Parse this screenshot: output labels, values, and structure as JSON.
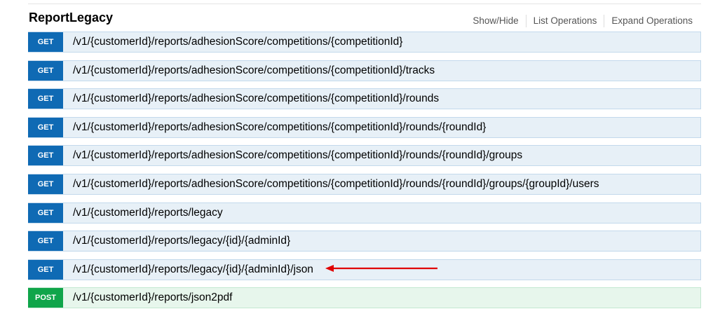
{
  "resource": {
    "title": "ReportLegacy",
    "actions": {
      "show_hide": "Show/Hide",
      "list_operations": "List Operations",
      "expand_operations": "Expand Operations"
    }
  },
  "endpoints": [
    {
      "method": "GET",
      "path": "/v1/{customerId}/reports/adhesionScore/competitions/{competitionId}"
    },
    {
      "method": "GET",
      "path": "/v1/{customerId}/reports/adhesionScore/competitions/{competitionId}/tracks"
    },
    {
      "method": "GET",
      "path": "/v1/{customerId}/reports/adhesionScore/competitions/{competitionId}/rounds"
    },
    {
      "method": "GET",
      "path": "/v1/{customerId}/reports/adhesionScore/competitions/{competitionId}/rounds/{roundId}"
    },
    {
      "method": "GET",
      "path": "/v1/{customerId}/reports/adhesionScore/competitions/{competitionId}/rounds/{roundId}/groups"
    },
    {
      "method": "GET",
      "path": "/v1/{customerId}/reports/adhesionScore/competitions/{competitionId}/rounds/{roundId}/groups/{groupId}/users"
    },
    {
      "method": "GET",
      "path": "/v1/{customerId}/reports/legacy"
    },
    {
      "method": "GET",
      "path": "/v1/{customerId}/reports/legacy/{id}/{adminId}"
    },
    {
      "method": "GET",
      "path": "/v1/{customerId}/reports/legacy/{id}/{adminId}/json"
    },
    {
      "method": "POST",
      "path": "/v1/{customerId}/reports/json2pdf"
    }
  ],
  "colors": {
    "get": "#0f6ab4",
    "post": "#10a54a",
    "get_row_bg": "#e7f0f7",
    "post_row_bg": "#e7f6ec",
    "annotation_arrow": "#e00000"
  },
  "annotation": {
    "icon": "red-arrow-icon"
  }
}
